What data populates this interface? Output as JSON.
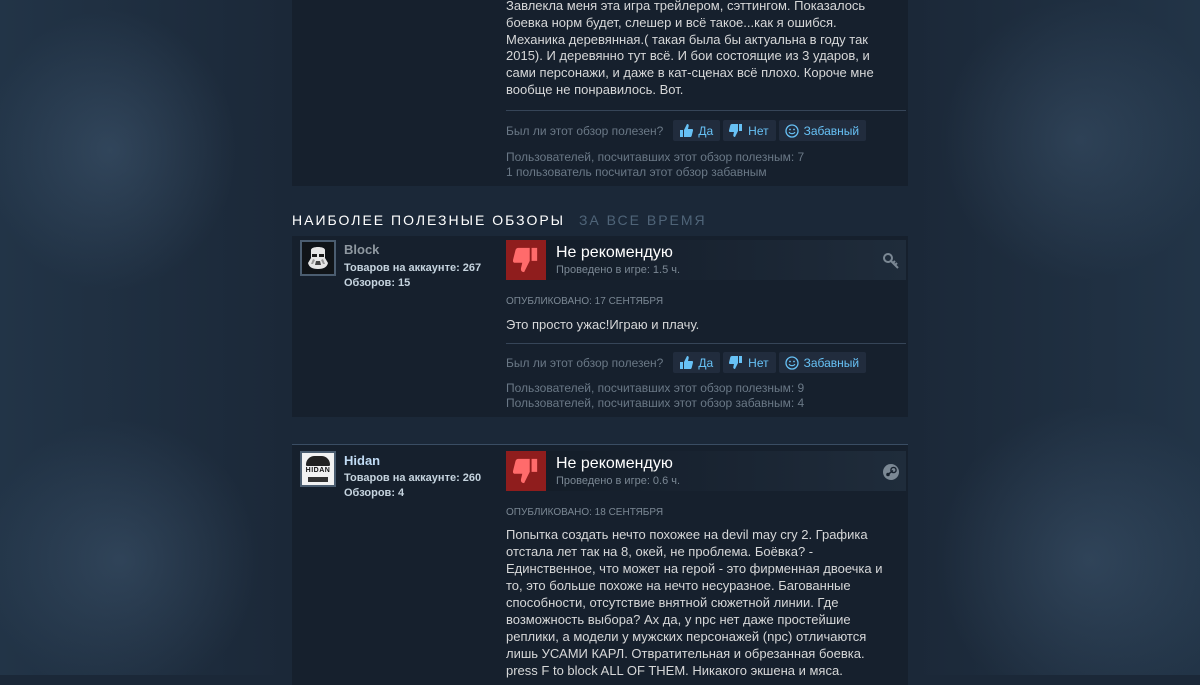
{
  "top_review": {
    "text": "Завлекла меня эта игра трейлером, сэттингом. Показалось боевка норм будет, слешер и всё такое...как я ошибся. Механика деревянная.( такая была бы актуальна в году так 2015). И деревянно тут всё. И бои состоящие из 3 ударов, и сами персонажи, и даже в кат-сценах всё плохо. Короче мне вообще не понравилось. Вот.",
    "helpful_question": "Был ли этот обзор полезен?",
    "yes": "Да",
    "no": "Нет",
    "funny": "Забавный",
    "stat_helpful": "Пользователей, посчитавших этот обзор полезным: 7",
    "stat_funny": "1 пользователь посчитал этот обзор забавным"
  },
  "section": {
    "title": "НАИБОЛЕЕ ПОЛЕЗНЫЕ ОБЗОРЫ",
    "subtitle": "ЗА ВСЕ ВРЕМЯ"
  },
  "reviews": [
    {
      "author": "Block",
      "products": "Товаров на аккаунте: 267",
      "review_count": "Обзоров: 15",
      "verdict": "Не рекомендую",
      "hours": "Проведено в игре: 1.5 ч.",
      "posted": "ОПУБЛИКОВАНО: 17 СЕНТЯБРЯ",
      "text": "Это просто ужас!Играю и плачу.",
      "helpful_question": "Был ли этот обзор полезен?",
      "yes": "Да",
      "no": "Нет",
      "funny": "Забавный",
      "stat_helpful": "Пользователей, посчитавших этот обзор полезным: 9",
      "stat_funny": "Пользователей, посчитавших этот обзор забавным: 4",
      "corner_icon": "key-icon",
      "name_color": "#8f98a0"
    },
    {
      "author": "Hidan",
      "avatar_text": "HIDAN",
      "products": "Товаров на аккаунте: 260",
      "review_count": "Обзоров: 4",
      "verdict": "Не рекомендую",
      "hours": "Проведено в игре: 0.6 ч.",
      "posted": "ОПУБЛИКОВАНО: 18 СЕНТЯБРЯ",
      "text": "Попытка создать нечто похожее на devil may cry 2. Графика отстала лет так на 8, окей, не проблема. Боёвка? - Единственное, что может на герой - это фирменная двоечка и то, это больше похоже на нечто несуразное. Багованные способности, отсутствие внятной сюжетной линии. Где возможность выбора? Ах да, у npc нет даже простейшие реплики, а модели у мужских персонажей (npc) отличаются лишь УСАМИ КАРЛ. Отвратительная и обрезанная боевка. press F to block ALL OF THEM. Никакого экшена и мяса.",
      "corner_icon": "steam-icon",
      "name_color": "#c1dbf4"
    }
  ],
  "colors": {
    "accent": "#67c1f5",
    "thumb_down": "#8f1d1d",
    "background": "#1b2838",
    "card": "#16202d"
  }
}
